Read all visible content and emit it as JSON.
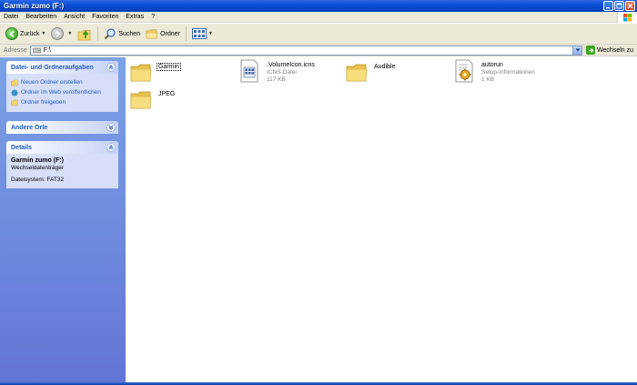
{
  "window": {
    "title": "Garmin zumo (F:)"
  },
  "menu": [
    "Datei",
    "Bearbeiten",
    "Ansicht",
    "Favoriten",
    "Extras",
    "?"
  ],
  "toolbar": {
    "back_label": "Zurück",
    "search_label": "Suchen",
    "folders_label": "Ordner"
  },
  "address": {
    "label": "Adresse",
    "value": "F:\\",
    "go_label": "Wechseln zu"
  },
  "taskpane": {
    "file_tasks": {
      "title": "Datei- und Ordneraufgaben",
      "items": [
        {
          "label": "Neuen Ordner erstellen",
          "icon": "new-folder-icon"
        },
        {
          "label": "Ordner im Web veröffentlichen",
          "icon": "web-publish-icon"
        },
        {
          "label": "Ordner freigeben",
          "icon": "share-folder-icon"
        }
      ]
    },
    "other_places": {
      "title": "Andere Orte"
    },
    "details": {
      "title": "Details",
      "name": "Garmin zumo (F:)",
      "type": "Wechseldatenträger",
      "filesystem": "Dateisystem: FAT32"
    }
  },
  "files": [
    {
      "name": "Garmin",
      "icon": "folder-icon",
      "selected": true
    },
    {
      "name": ".VolumeIcon.icns",
      "type": "ICNS-Datei",
      "size": "117 KB",
      "icon": "icns-file-icon"
    },
    {
      "name": "Audible",
      "icon": "folder-icon"
    },
    {
      "name": "autorun",
      "type": "Setup-Informationen",
      "size": "1 KB",
      "icon": "setup-info-icon"
    },
    {
      "name": "JPEG",
      "icon": "folder-icon"
    }
  ],
  "colors": {
    "titlebar": "#0a4fd4",
    "taskpane": "#6375d6",
    "link": "#215dc6",
    "chrome": "#ece9d8"
  }
}
